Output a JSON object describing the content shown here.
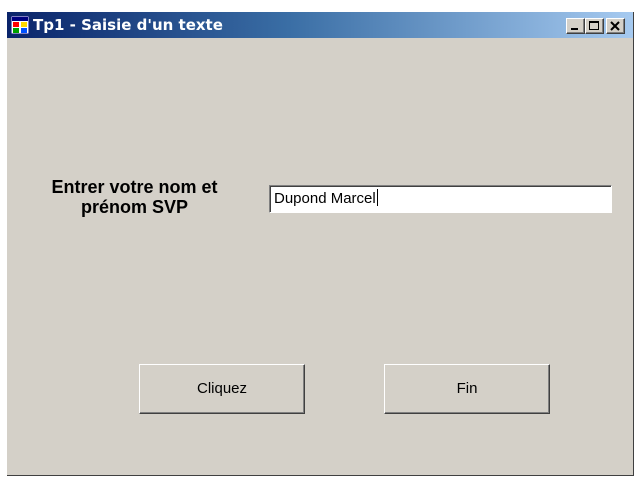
{
  "window": {
    "title": "Tp1 - Saisie d'un texte",
    "title_icon": "app-window-icon",
    "controls": [
      "minimize-icon",
      "maximize-icon",
      "close-icon"
    ]
  },
  "form": {
    "prompt_line1": "Entrer votre nom et",
    "prompt_line2": "prénom SVP",
    "name_value": "Dupond Marcel"
  },
  "buttons": {
    "cliquez_label": "Cliquez",
    "fin_label": "Fin"
  },
  "colors": {
    "window_bg": "#d4d0c8",
    "title_gradient_start": "#0a246a",
    "title_gradient_end": "#a6caf0",
    "title_text": "#ffffff"
  }
}
